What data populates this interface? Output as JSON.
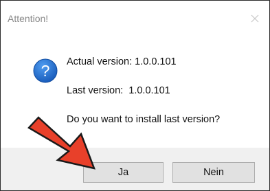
{
  "window": {
    "title": "Attention!",
    "close_icon": "close-icon"
  },
  "message": {
    "icon": "question-icon",
    "actual_version": "Actual version: 1.0.0.101",
    "last_version": "Last version:  1.0.0.101",
    "prompt": "Do you want to install last version?"
  },
  "buttons": {
    "yes_label": "Ja",
    "no_label": "Nein"
  },
  "annotation": {
    "arrow_icon": "red-arrow-icon",
    "arrow_color": "#e8402a"
  },
  "colors": {
    "icon_blue": "#1a6fd8",
    "footer_bg": "#f0f0f0",
    "button_bg": "#e1e1e1"
  }
}
